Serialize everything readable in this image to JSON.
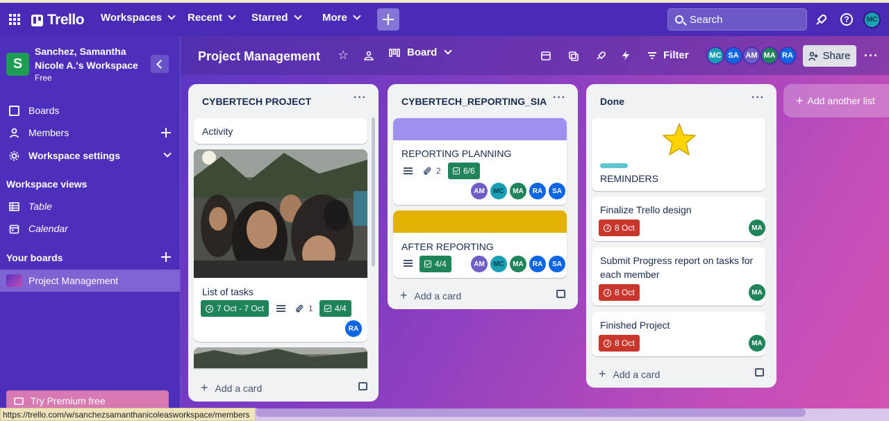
{
  "topbar": {
    "brand": "Trello",
    "menus": [
      "Workspaces",
      "Recent",
      "Starred",
      "More"
    ],
    "search_placeholder": "Search",
    "help": "?",
    "user_initials": "MC"
  },
  "sidebar": {
    "workspace_initial": "S",
    "workspace_name": "Sanchez, Samantha Nicole A.'s Workspace",
    "plan": "Free",
    "items": [
      {
        "label": "Boards",
        "icon": "trello-board-icon"
      },
      {
        "label": "Members",
        "icon": "person-icon"
      },
      {
        "label": "Workspace settings",
        "icon": "gear-icon"
      }
    ],
    "views_heading": "Workspace views",
    "views": [
      {
        "label": "Table",
        "icon": "table-icon"
      },
      {
        "label": "Calendar",
        "icon": "calendar-icon"
      }
    ],
    "boards_heading": "Your boards",
    "boards": [
      {
        "label": "Project Management"
      }
    ],
    "premium": "Try Premium free"
  },
  "board": {
    "title": "Project Management",
    "view": "Board",
    "filter": "Filter",
    "share": "Share",
    "members": [
      {
        "initials": "MC",
        "color": "#1a9fb5"
      },
      {
        "initials": "SA",
        "color": "#0c66e4"
      },
      {
        "initials": "AM",
        "color": "#6e5dc6"
      },
      {
        "initials": "MA",
        "color": "#1f845a"
      },
      {
        "initials": "RA",
        "color": "#0c66e4"
      }
    ],
    "add_list": "Add another list",
    "add_card": "Add a card",
    "lists": [
      {
        "title": "CYBERTECH PROJECT",
        "cards": [
          {
            "title": "Activity"
          },
          {
            "title": "List of tasks",
            "dates": "7 Oct - 7 Oct",
            "attachments": "1",
            "checklist": "4/4",
            "members": [
              "RA"
            ]
          }
        ]
      },
      {
        "title": "CYBERTECH_REPORTING_SIA",
        "cards": [
          {
            "title": "REPORTING PLANNING",
            "cover": "#9f8fef",
            "attachments": "2",
            "checklist": "6/6",
            "members": [
              "AM",
              "MC",
              "MA",
              "RA",
              "SA"
            ]
          },
          {
            "title": "AFTER REPORTING",
            "cover": "#e2b203",
            "checklist": "4/4",
            "members": [
              "AM",
              "MC",
              "MA",
              "RA",
              "SA"
            ]
          }
        ]
      },
      {
        "title": "Done",
        "cards": [
          {
            "title": "REMINDERS",
            "label_color": "#60c6d2"
          },
          {
            "title": "Finalize Trello design",
            "due": "8 Oct",
            "members": [
              "MA"
            ]
          },
          {
            "title": "Submit Progress report on tasks for each member",
            "due": "8 Oct",
            "members": [
              "MA"
            ]
          },
          {
            "title": "Finished Project",
            "due": "8 Oct",
            "members": [
              "MA"
            ]
          }
        ]
      }
    ]
  },
  "statusbar": {
    "url": "https://trello.com/w/sanchezsamanthanicoleasworkspace/members"
  },
  "colors": {
    "topbar": "#4a2bb5",
    "sidebar": "#4e2fbb",
    "overdue": "#c9372c",
    "complete": "#1f845a"
  }
}
